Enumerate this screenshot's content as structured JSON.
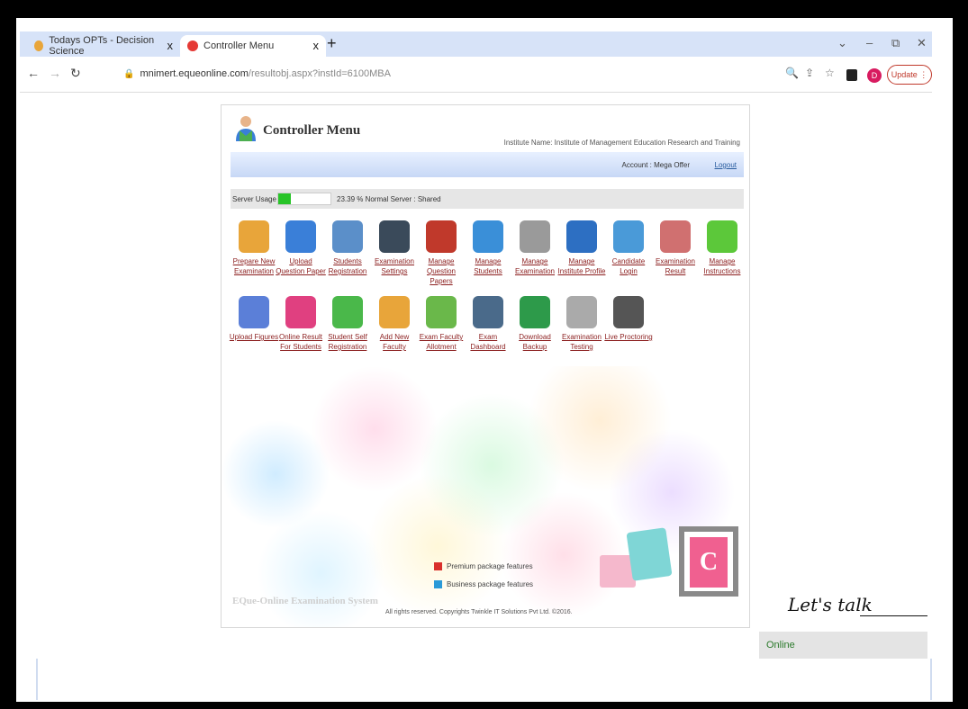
{
  "browser": {
    "tabs": [
      {
        "label": "Todays OPTs - Decision Science",
        "close": "x",
        "active": false
      },
      {
        "label": "Controller Menu",
        "close": "x",
        "active": true
      }
    ],
    "new_tab": "+",
    "url_host": "mnimert.equeonline.com",
    "url_path": "/resultobj.aspx?instId=6100MBA",
    "profile_initial": "D",
    "update_label": "Update ⋮",
    "win_min": "–",
    "win_max": "⧉",
    "win_close": "✕",
    "chevron": "⌄"
  },
  "page": {
    "title": "Controller Menu",
    "institute_label": "Institute Name: Institute of Management Education Research and Training",
    "account_label": "Account : Mega Offer",
    "logout_label": "Logout",
    "server_usage_label": "Server Usage",
    "server_usage_percent": 23.39,
    "server_info": "23.39 %  Normal  Server : Shared",
    "tiles_row1": [
      {
        "label": "Prepare New Examination",
        "icon": "question-icon",
        "color": "#e8a53a"
      },
      {
        "label": "Upload Question Paper",
        "icon": "upload-paper-icon",
        "color": "#3a7fd8"
      },
      {
        "label": "Students Registration",
        "icon": "registration-icon",
        "color": "#5b8fc9"
      },
      {
        "label": "Examination Settings",
        "icon": "laptop-icon",
        "color": "#3a4a5a"
      },
      {
        "label": "Manage Question Papers",
        "icon": "checklist-icon",
        "color": "#c0392b"
      },
      {
        "label": "Manage Students",
        "icon": "students-icon",
        "color": "#3a8fd8"
      },
      {
        "label": "Manage Examination",
        "icon": "exam-icon",
        "color": "#9a9a9a"
      },
      {
        "label": "Manage Institute Profile",
        "icon": "globe-icon",
        "color": "#2d6fc2"
      },
      {
        "label": "Candidate Login",
        "icon": "candidate-icon",
        "color": "#4a9ad8"
      },
      {
        "label": "Examination Result",
        "icon": "result-icon",
        "color": "#d07070"
      },
      {
        "label": "Manage Instructions",
        "icon": "info-icon",
        "color": "#5cc83a"
      }
    ],
    "tiles_row2": [
      {
        "label": "Upload Figures",
        "icon": "figures-icon",
        "color": "#5b7fd8"
      },
      {
        "label": "Online Result For Students",
        "icon": "bar-chart-icon",
        "color": "#e04080"
      },
      {
        "label": "Student Self Registration",
        "icon": "self-registration-icon",
        "color": "#4ab84a"
      },
      {
        "label": "Add New Faculty",
        "icon": "faculty-icon",
        "color": "#e8a53a"
      },
      {
        "label": "Exam Faculty Allotment",
        "icon": "allotment-icon",
        "color": "#6ab84a"
      },
      {
        "label": "Exam Dashboard",
        "icon": "dashboard-icon",
        "color": "#4a6a8a"
      },
      {
        "label": "Download Backup",
        "icon": "backup-icon",
        "color": "#2d9a4a"
      },
      {
        "label": "Examination Testing",
        "icon": "testing-icon",
        "color": "#aaaaaa"
      },
      {
        "label": "Live Proctoring",
        "icon": "webcam-icon",
        "color": "#555555"
      }
    ],
    "legend_premium": "Premium package features",
    "legend_business": "Business package features",
    "premium_color": "#d9302c",
    "business_color": "#2a9ad8",
    "brand": "EQue-Online Examination System",
    "copyright": "All rights reserved. Copyrights Twinkle IT Solutions Pvt Ltd. ©2016.",
    "logo_letter": "C"
  },
  "chat": {
    "title": "Let's talk",
    "status": "Online"
  }
}
